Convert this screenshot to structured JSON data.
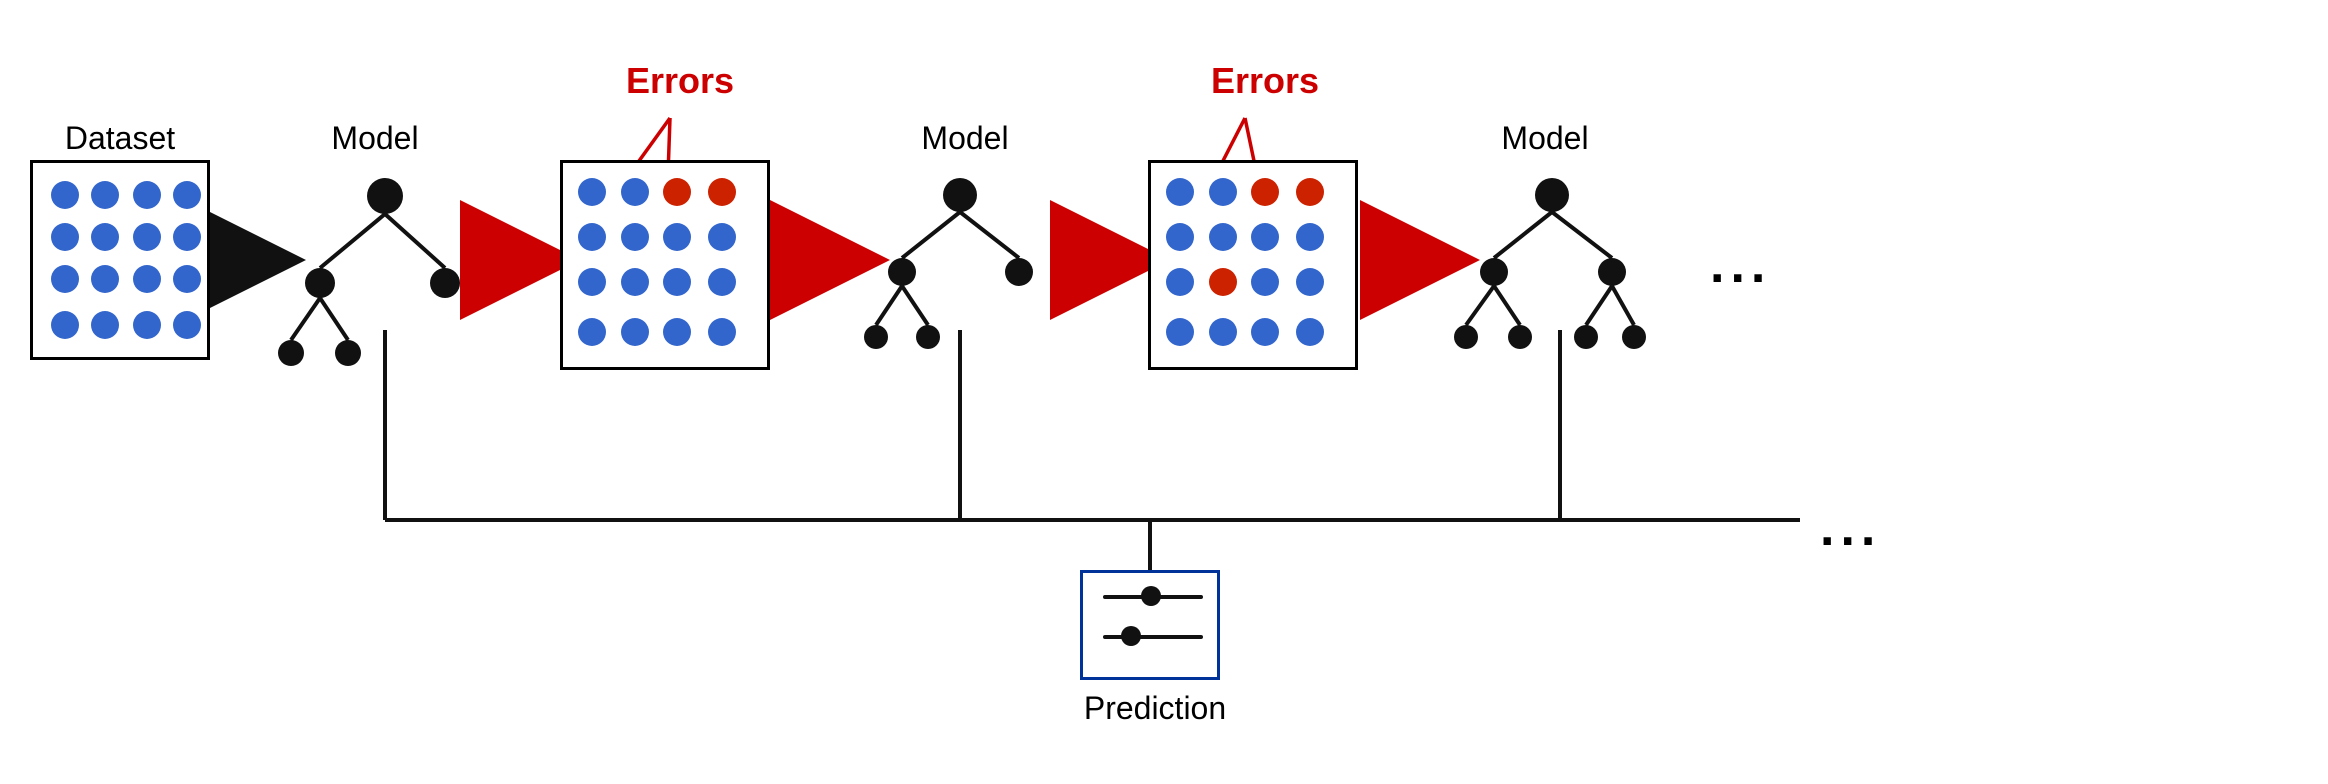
{
  "labels": {
    "dataset": "Dataset",
    "model1": "Model",
    "model2": "Model",
    "model3": "Model",
    "errors1": "Errors",
    "errors2": "Errors",
    "prediction": "Prediction",
    "ellipsis1": "...",
    "ellipsis2": "..."
  },
  "colors": {
    "blue_dot": "#3a6ec4",
    "red_dot": "#cc2200",
    "black": "#111111",
    "red_arrow": "#cc0000",
    "border": "#000000",
    "prediction_border": "#003399"
  }
}
